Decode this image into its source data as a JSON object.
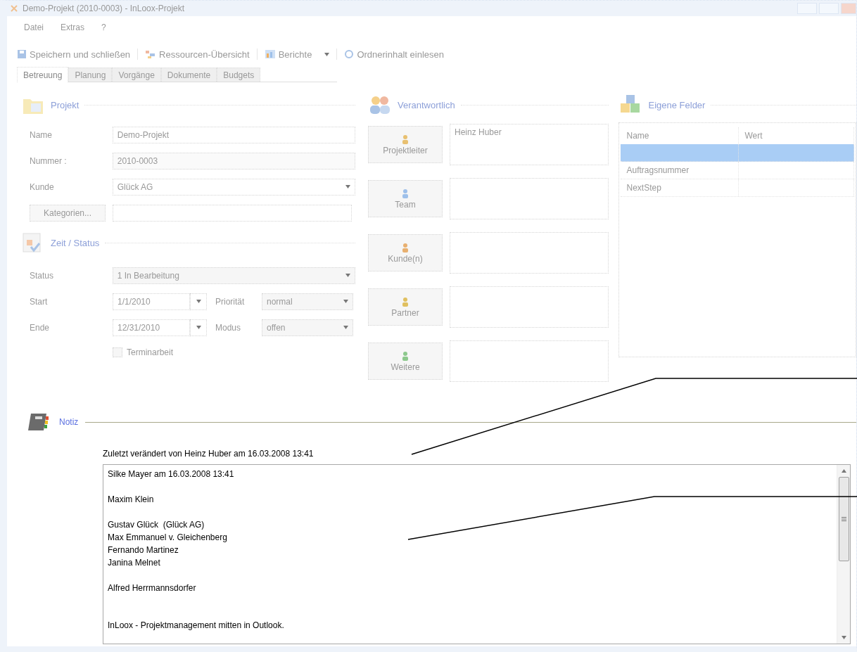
{
  "window": {
    "title": "Demo-Projekt (2010-0003) - InLoox-Projekt"
  },
  "menu": [
    "Datei",
    "Extras",
    "?"
  ],
  "toolbar": [
    {
      "label": "Speichern und schließen",
      "dropdown": false
    },
    {
      "label": "Ressourcen-Übersicht",
      "dropdown": false
    },
    {
      "label": "Berichte",
      "dropdown": true
    },
    {
      "label": "Ordnerinhalt einlesen",
      "dropdown": false
    }
  ],
  "tabs": [
    {
      "label": "Betreuung",
      "selected": true
    },
    {
      "label": "Planung",
      "selected": false
    },
    {
      "label": "Vorgänge",
      "selected": false
    },
    {
      "label": "Dokumente",
      "selected": false
    },
    {
      "label": "Budgets",
      "selected": false
    }
  ],
  "projekt": {
    "title": "Projekt",
    "fields": [
      {
        "label": "Name",
        "value": "Demo-Projekt",
        "kind": "text"
      },
      {
        "label": "Nummer :",
        "value": "2010-0003",
        "kind": "readonly"
      },
      {
        "label": "Kunde",
        "value": "Glück AG",
        "kind": "combo"
      }
    ],
    "categories_button": "Kategorien..."
  },
  "zeit_status": {
    "title": "Zeit / Status",
    "status": {
      "label": "Status",
      "value": "1 In Bearbeitung"
    },
    "start": {
      "label": "Start",
      "value": "1/1/2010"
    },
    "prioritaet": {
      "label": "Priorität",
      "value": "normal"
    },
    "ende": {
      "label": "Ende",
      "value": "12/31/2010"
    },
    "modus": {
      "label": "Modus",
      "value": "offen"
    },
    "terminarbeit": {
      "label": "Terminarbeit",
      "checked": false
    }
  },
  "verantwortlich": {
    "title": "Verantwortlich",
    "roles": [
      {
        "label": "Projektleiter",
        "names": "Heinz Huber"
      },
      {
        "label": "Team"
      },
      {
        "label": "Kunde(n)"
      },
      {
        "label": "Partner"
      },
      {
        "label": "Weitere"
      }
    ]
  },
  "eigene_felder": {
    "title": "Eigene Felder",
    "columns": [
      "Name",
      "Wert"
    ],
    "rows": [
      {
        "selected": true
      },
      {
        "name": "Auftragsnummer",
        "selected": false
      },
      {
        "name": "NextStep",
        "selected": false
      }
    ]
  },
  "notiz": {
    "title": "Notiz",
    "changed": "Zuletzt verändert von Heinz Huber am 16.03.2008 13:41",
    "paragraphs": [
      [
        "Silke Mayer am 16.03.2008 13:41"
      ],
      [
        "Maxim Klein"
      ],
      [
        "Gustav Glück  (Glück AG)",
        "Max Emmanuel v. Gleichenberg",
        "Fernando Martinez",
        "Janina Melnet"
      ],
      [
        "Alfred Herrmannsdorfer"
      ],
      [
        "InLoox - Projektmanagement mitten in Outlook."
      ]
    ]
  }
}
